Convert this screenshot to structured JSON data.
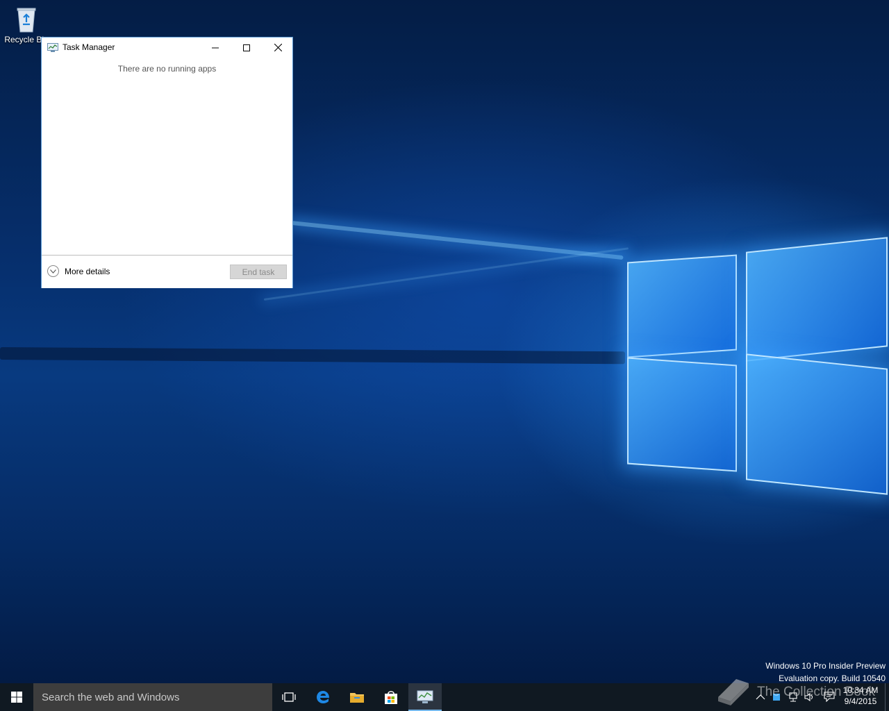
{
  "desktop": {
    "recycle_bin_label": "Recycle Bin"
  },
  "task_manager": {
    "title": "Task Manager",
    "empty_message": "There are no running apps",
    "more_details_label": "More details",
    "end_task_label": "End task"
  },
  "watermark": {
    "line1": "Windows 10 Pro Insider Preview",
    "line2": "Evaluation copy. Build 10540"
  },
  "taskbar": {
    "search_placeholder": "Search the web and Windows",
    "pinned": [
      "task-view",
      "edge",
      "file-explorer",
      "store",
      "task-manager"
    ],
    "active_app": "task-manager",
    "clock_time": "10:34 AM",
    "clock_date": "9/4/2015"
  },
  "overlay": {
    "brand_text": "The Collection Book"
  },
  "colors": {
    "window_border": "#5a9ad6",
    "taskbar_bg": "#101922",
    "search_bg": "#3d3d3d",
    "active_underline": "#76b9ed"
  }
}
